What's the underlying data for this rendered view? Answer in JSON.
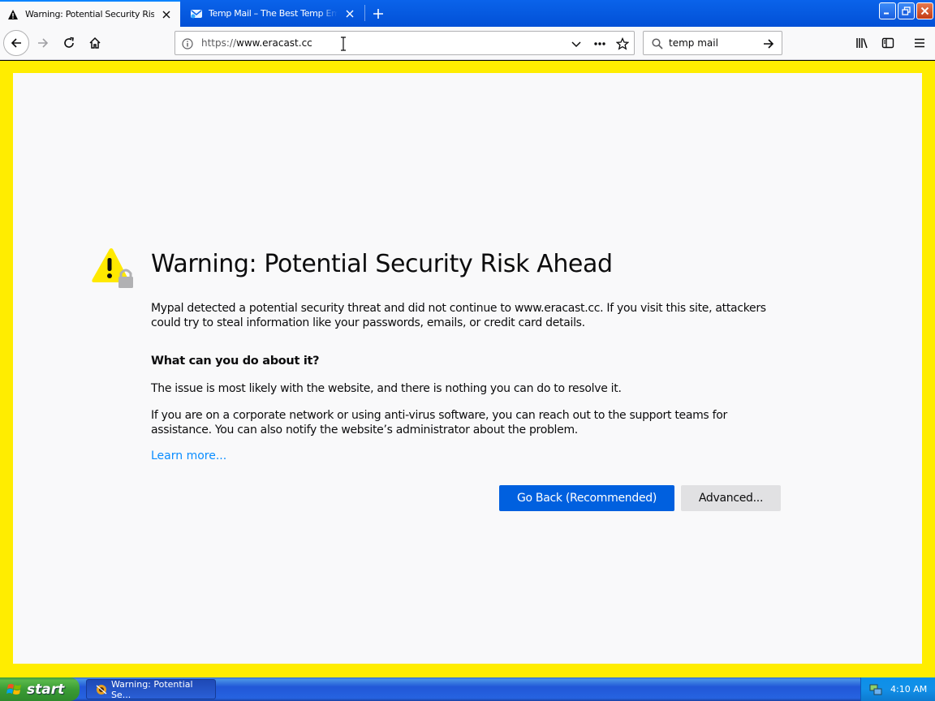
{
  "browser": {
    "tabs": [
      {
        "title": "Warning: Potential Security Risk Ahead",
        "active": true,
        "icon": "warning-icon"
      },
      {
        "title": "Temp Mail – The Best Temp Email Service",
        "active": false,
        "icon": "temp-mail-icon"
      }
    ],
    "url": {
      "scheme": "https://",
      "host": "www.eracast.cc"
    },
    "search": {
      "value": "temp mail"
    }
  },
  "error_page": {
    "heading": "Warning: Potential Security Risk Ahead",
    "intro": "Mypal detected a potential security threat and did not continue to www.eracast.cc. If you visit this site, attackers could try to steal information like your passwords, emails, or credit card details.",
    "what_heading": "What can you do about it?",
    "issue_text": "The issue is most likely with the website, and there is nothing you can do to resolve it.",
    "network_text": "If you are on a corporate network or using anti-virus software, you can reach out to the support teams for assistance. You can also notify the website’s administrator about the problem.",
    "learn_more": "Learn more...",
    "go_back": "Go Back (Recommended)",
    "advanced": "Advanced..."
  },
  "taskbar": {
    "start_label": "start",
    "task_label": "Warning: Potential Se...",
    "clock": "4:10 AM"
  },
  "colors": {
    "accent": "#0060df",
    "border_highlight": "#ffed00",
    "link": "#0a8dff",
    "page_bg": "#f9f9fa",
    "warning_yellow": "#ffe900"
  }
}
